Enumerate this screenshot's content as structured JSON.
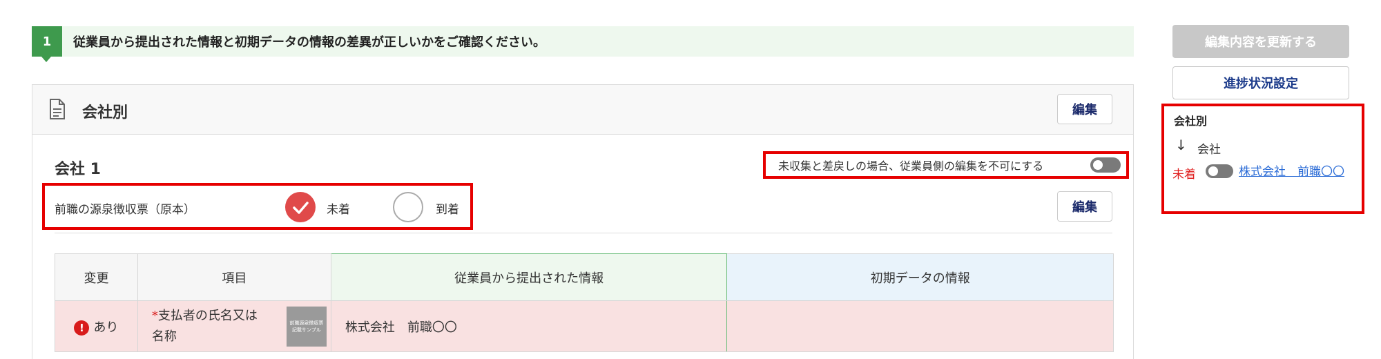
{
  "step": {
    "number": "1",
    "text": "従業員から提出された情報と初期データの情報の差異が正しいかをご確認ください。"
  },
  "card": {
    "title": "会社別",
    "edit_label": "編集",
    "company_name": "会社 1",
    "toggle_text": "未収集と差戻しの場合、従業員側の編集を不可にする",
    "toggle_on": false,
    "document": {
      "label": "前職の源泉徴収票（原本）",
      "options": [
        "未着",
        "到着"
      ],
      "selected": "未着"
    },
    "section_edit_label": "編集"
  },
  "table": {
    "headers": [
      "変更",
      "項目",
      "従業員から提出された情報",
      "初期データの情報"
    ],
    "rows": [
      {
        "change_icon": "!",
        "change": "あり",
        "required_mark": "*",
        "item": "支払者の氏名又は名称",
        "thumb_text": "前職源泉徴収票 記載サンプル",
        "employee_value": "株式会社　前職〇〇",
        "initial_value": ""
      }
    ]
  },
  "side": {
    "update_button": "編集内容を更新する",
    "progress_button": "進捗状況設定",
    "panel_title": "会社別",
    "arrow": "↓",
    "company_label": "会社",
    "status": "未着",
    "link": "株式会社　前職〇〇"
  },
  "colors": {
    "accent_green": "#3e9a4d",
    "error_red": "#e60000",
    "link_blue": "#2a6bd6",
    "navy": "#1b2a6b"
  }
}
